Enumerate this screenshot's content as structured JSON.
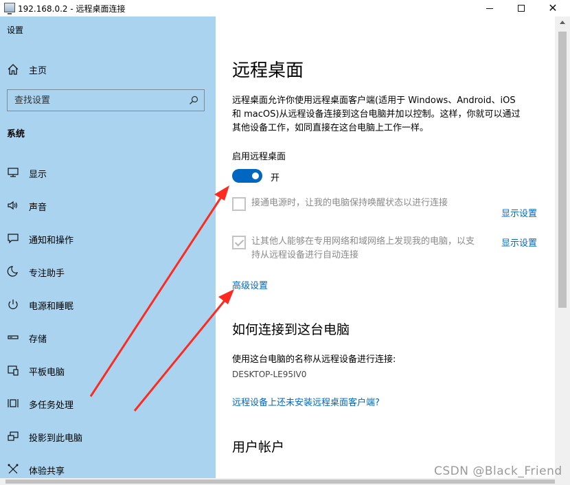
{
  "window": {
    "title": "192.168.0.2 - 远程桌面连接",
    "minimize": "—",
    "maximize": "□",
    "close": "✕"
  },
  "sidebar": {
    "app_title": "设置",
    "home_label": "主页",
    "search_placeholder": "查找设置",
    "section_title": "系统",
    "items": [
      {
        "label": "显示",
        "icon": "display-icon"
      },
      {
        "label": "声音",
        "icon": "speaker-icon"
      },
      {
        "label": "通知和操作",
        "icon": "notification-icon"
      },
      {
        "label": "专注助手",
        "icon": "moon-icon"
      },
      {
        "label": "电源和睡眠",
        "icon": "power-icon"
      },
      {
        "label": "存储",
        "icon": "storage-icon"
      },
      {
        "label": "平板电脑",
        "icon": "tablet-icon"
      },
      {
        "label": "多任务处理",
        "icon": "multitask-icon"
      },
      {
        "label": "投影到此电脑",
        "icon": "project-icon"
      },
      {
        "label": "体验共享",
        "icon": "share-icon"
      }
    ]
  },
  "main": {
    "title": "远程桌面",
    "description_lines": [
      "远程桌面允许你使用远程桌面客户端(适用于 Windows、Android、iOS",
      "和 macOS)从远程设备连接到这台电脑并加以控制。这样，你就可以通过",
      "其他设备工作，如同直接在这台电脑上工作一样。"
    ],
    "enable_label": "启用远程桌面",
    "toggle_state": "开",
    "toggle_on": true,
    "option1_text": "接通电源时，让我的电脑保持唤醒状态以进行连接",
    "option1_link": "显示设置",
    "option2_line1": "让其他人能够在专用网络和域网络上发现我的电脑，以支",
    "option2_line2": "持从远程设备进行自动连接",
    "option2_link": "显示设置",
    "advanced_link": "高级设置",
    "how_title": "如何连接到这台电脑",
    "how_text": "使用这台电脑的名称从远程设备进行连接:",
    "pc_name": "DESKTOP-LE95IV0",
    "client_link": "远程设备上还未安装远程桌面客户端?",
    "user_title": "用户帐户"
  },
  "watermark": "CSDN @Black_Friend",
  "colors": {
    "sidebar_bg": "#a9d3ee",
    "accent": "#0067c0",
    "annotation_arrow": "#ff2a1f"
  }
}
